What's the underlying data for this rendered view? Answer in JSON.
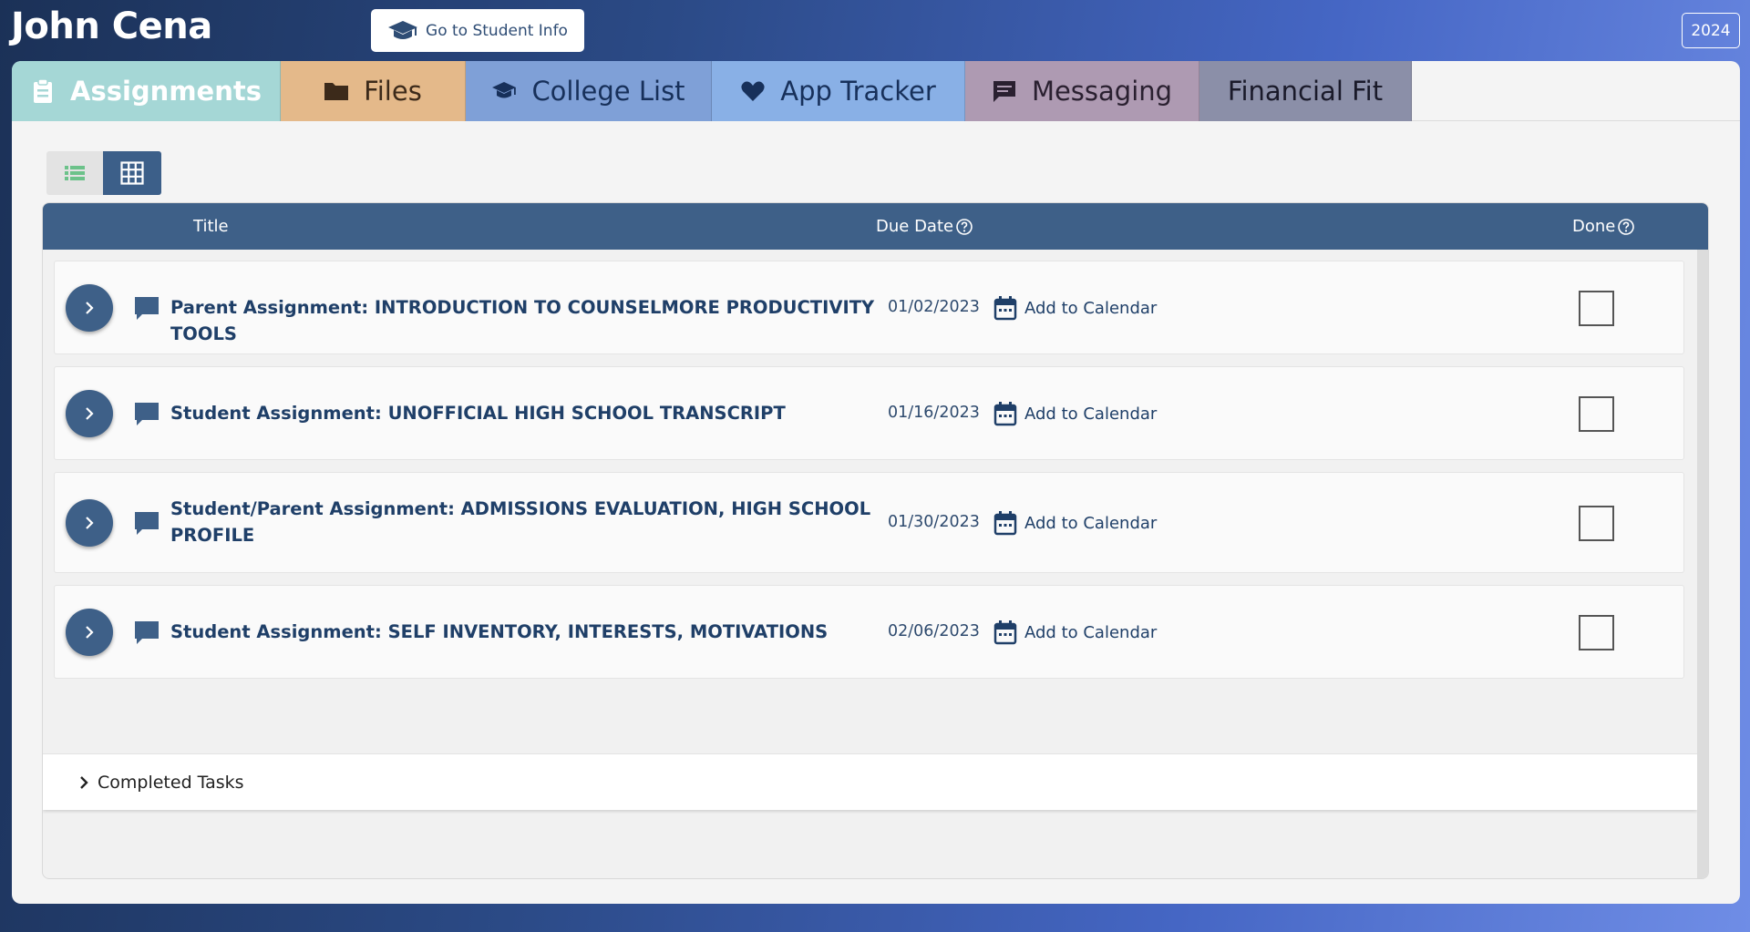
{
  "header": {
    "student_name": "John Cena",
    "goto_button": "Go to Student Info",
    "year": "2024"
  },
  "tabs": [
    {
      "label": "Assignments",
      "icon": "clipboard-icon",
      "active": true,
      "color": "#a5d7d6"
    },
    {
      "label": "Files",
      "icon": "folder-icon",
      "color": "#e4b98a"
    },
    {
      "label": "College List",
      "icon": "graduation-cap-icon",
      "color": "#7fa0d7"
    },
    {
      "label": "App Tracker",
      "icon": "heart-icon",
      "color": "#89b0e6"
    },
    {
      "label": "Messaging",
      "icon": "message-icon",
      "color": "#ae9ab2"
    },
    {
      "label": "Financial Fit",
      "color": "#8b8fa8"
    }
  ],
  "view_toggle": {
    "active": "grid"
  },
  "table": {
    "columns": {
      "title": "Title",
      "due_date": "Due Date",
      "done": "Done"
    },
    "rows": [
      {
        "title": "Parent Assignment: INTRODUCTION TO COUNSELMORE PRODUCTIVITY TOOLS",
        "due": "01/02/2023",
        "calendar": "Add to Calendar",
        "done": false
      },
      {
        "title": "Student Assignment: UNOFFICIAL HIGH SCHOOL TRANSCRIPT",
        "due": "01/16/2023",
        "calendar": "Add to Calendar",
        "done": false
      },
      {
        "title": "Student/Parent Assignment: ADMISSIONS EVALUATION, HIGH SCHOOL PROFILE",
        "due": "01/30/2023",
        "calendar": "Add to Calendar",
        "done": false
      },
      {
        "title": "Student Assignment: SELF INVENTORY, INTERESTS, MOTIVATIONS",
        "due": "02/06/2023",
        "calendar": "Add to Calendar",
        "done": false
      }
    ],
    "completed_label": "Completed Tasks"
  },
  "colors": {
    "header_blue": "#3e6088",
    "title_text": "#1f3f68"
  }
}
